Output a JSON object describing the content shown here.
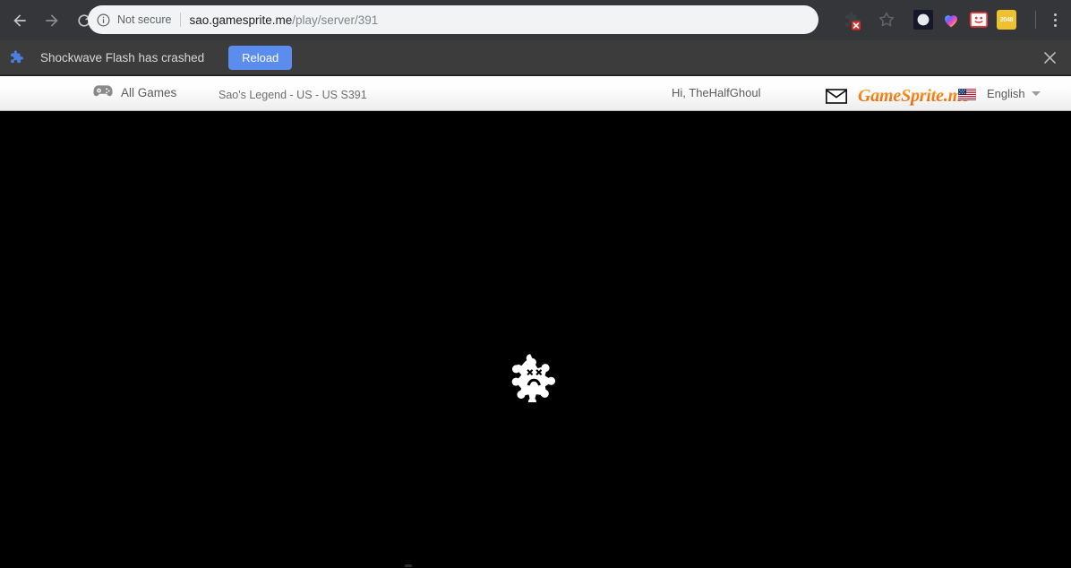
{
  "browser": {
    "back_icon": "back-arrow-icon",
    "forward_icon": "forward-arrow-icon",
    "reload_icon": "reload-icon",
    "security_icon": "info-circle-icon",
    "security_label": "Not secure",
    "url_host": "sao.gamesprite.me",
    "url_path": "/play/server/391",
    "url_full": "sao.gamesprite.me/play/server/391",
    "extensions_puzzle_icon": "puzzle-piece-blocked-icon",
    "bookmark_icon": "star-outline-icon",
    "menu_icon": "three-dot-menu-icon",
    "extensions": [
      {
        "name": "moon-extension-icon",
        "label": ""
      },
      {
        "name": "rainbow-heart-extension-icon",
        "label": ""
      },
      {
        "name": "card-face-extension-icon",
        "label": ""
      },
      {
        "name": "2048-extension-icon",
        "label": "2048"
      }
    ]
  },
  "infobar": {
    "icon": "blue-puzzle-piece-icon",
    "message": "Shockwave Flash has crashed",
    "reload_label": "Reload",
    "close_icon": "close-icon",
    "accent_color": "#5b8def",
    "background_color": "#3c3c3c"
  },
  "site_header": {
    "gamepad_icon": "gamepad-icon",
    "all_games_label": "All Games",
    "game_title": "Sao's Legend - US - US S391",
    "greeting": "Hi, TheHalfGhoul",
    "mail_icon": "envelope-icon",
    "logo_text": "GameSprite.me",
    "logo_color": "#ef7c12",
    "flag_icon": "us-flag-icon",
    "language_label": "English",
    "language_caret_icon": "chevron-down-icon"
  },
  "content": {
    "background_color": "#000000",
    "plugin_crash_icon": "sad-puzzle-piece-icon"
  }
}
